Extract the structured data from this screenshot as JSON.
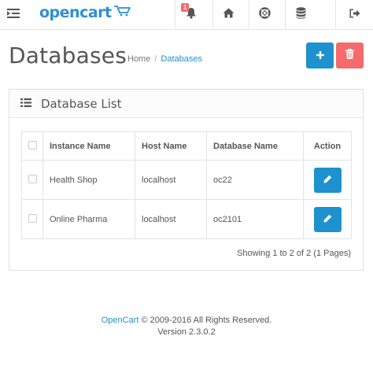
{
  "header": {
    "logo_text": "opencart",
    "alert_count": "1"
  },
  "page": {
    "title": "Databases",
    "breadcrumb": {
      "home": "Home",
      "separator": "/",
      "current": "Databases"
    }
  },
  "panel": {
    "title": "Database List",
    "columns": [
      "Instance Name",
      "Host Name",
      "Database Name",
      "Action"
    ],
    "rows": [
      {
        "instance": "Health Shop",
        "host": "localhost",
        "database": "oc22"
      },
      {
        "instance": "Online Pharma",
        "host": "localhost",
        "database": "oc2101"
      }
    ],
    "pagination": "Showing 1 to 2 of 2 (1 Pages)"
  },
  "footer": {
    "brand": "OpenCart",
    "copyright": " © 2009-2016 All Rights Reserved.",
    "version": "Version 2.3.0.2"
  },
  "colors": {
    "primary": "#1e91cf",
    "danger": "#f56b6b"
  },
  "icons": [
    "menu-toggle-icon",
    "cart-icon",
    "bell-icon",
    "home-icon",
    "life-ring-icon",
    "database-icon",
    "sign-out-icon",
    "plus-icon",
    "trash-icon",
    "list-icon",
    "pencil-icon"
  ]
}
